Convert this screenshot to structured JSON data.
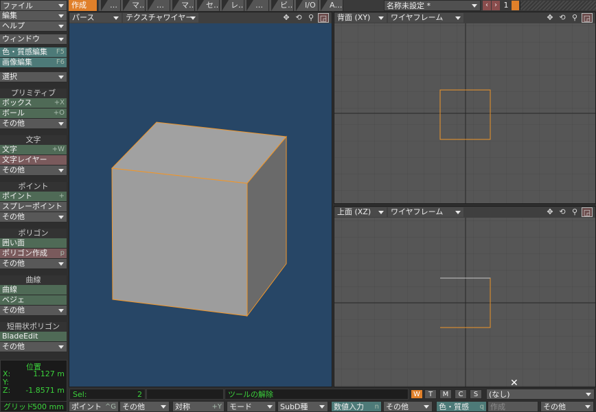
{
  "menu": {
    "file": "ファイル",
    "edit": "編集",
    "help": "ヘルプ",
    "window": "ウィンドウ"
  },
  "tabs": [
    "作成",
    "…",
    "マ…",
    "…",
    "マ…",
    "セ…",
    "レ…",
    "…",
    "ビ…",
    "I/O",
    "A…"
  ],
  "scene": {
    "name": "名称未設定 *",
    "layer_number": "1"
  },
  "left_panel": {
    "editors": [
      {
        "label": "色・質感編集",
        "shortcut": "F5"
      },
      {
        "label": "画像編集",
        "shortcut": "F6"
      }
    ],
    "select": "選択",
    "sections": [
      {
        "title": "プリミティブ",
        "items": [
          {
            "label": "ボックス",
            "shortcut": "+X"
          },
          {
            "label": "ボール",
            "shortcut": "+O"
          },
          {
            "label": "その他",
            "dropdown": true
          }
        ]
      },
      {
        "title": "文字",
        "items": [
          {
            "label": "文字",
            "shortcut": "+W"
          },
          {
            "label": "文字レイヤー",
            "shortcut": ""
          },
          {
            "label": "その他",
            "dropdown": true
          }
        ]
      },
      {
        "title": "ポイント",
        "items": [
          {
            "label": "ポイント",
            "shortcut": "+"
          },
          {
            "label": "スプレーポイント",
            "shortcut": ""
          },
          {
            "label": "その他",
            "dropdown": true
          }
        ]
      },
      {
        "title": "ポリゴン",
        "items": [
          {
            "label": "囲い面",
            "shortcut": ""
          },
          {
            "label": "ポリゴン作成",
            "shortcut": "p"
          },
          {
            "label": "その他",
            "dropdown": true
          }
        ]
      },
      {
        "title": "曲線",
        "items": [
          {
            "label": "曲線",
            "shortcut": ""
          },
          {
            "label": "ベジェ",
            "shortcut": ""
          },
          {
            "label": "その他",
            "dropdown": true
          }
        ]
      },
      {
        "title": "短冊状ポリゴン",
        "items": [
          {
            "label": "BladeEdit",
            "shortcut": ""
          },
          {
            "label": "その他",
            "dropdown": true
          }
        ]
      }
    ],
    "position": {
      "title": "位置",
      "x_label": "X:",
      "x_value": "1.127 m",
      "y_label": "Y:",
      "y_value": "",
      "z_label": "Z:",
      "z_value": "-1.8571 m"
    }
  },
  "viewports": {
    "perspective": {
      "view": "パース",
      "mode": "テクスチャワイヤー"
    },
    "back": {
      "view": "背面 (XY)",
      "mode": "ワイヤフレーム"
    },
    "top": {
      "view": "上面 (XZ)",
      "mode": "ワイヤフレーム"
    },
    "icons": [
      "move-icon",
      "rotate-icon",
      "zoom-icon",
      "maximize-icon"
    ]
  },
  "status": {
    "sel_label": "Sel:",
    "sel_count": "2",
    "message": "ツールの解除",
    "modes": [
      "W",
      "T",
      "M",
      "C",
      "S"
    ],
    "active_mode": "W",
    "surface": "(なし)"
  },
  "bottom_bar": {
    "grid_label": "グリッド:",
    "grid_value": "500 mm",
    "buttons": [
      {
        "label": "ポイント",
        "shortcut": "^G"
      },
      {
        "label": "その他",
        "dropdown": true
      },
      {
        "label": "対称",
        "shortcut": "+Y"
      },
      {
        "label": "モード",
        "dropdown": true
      },
      {
        "label": "SubD種",
        "dropdown": true
      },
      {
        "label": "数値入力",
        "shortcut": "n"
      },
      {
        "label": "その他",
        "dropdown": true
      },
      {
        "label": "色・質感",
        "shortcut": "q"
      },
      {
        "label": "作成",
        "shortcut": ""
      },
      {
        "label": "その他",
        "dropdown": true
      }
    ]
  },
  "colors": {
    "accent": "#e0802a",
    "viewport_persp": "#274666",
    "viewport_ortho": "#565656",
    "selection_edge": "#f0962a",
    "status_text": "#3bd23b"
  }
}
